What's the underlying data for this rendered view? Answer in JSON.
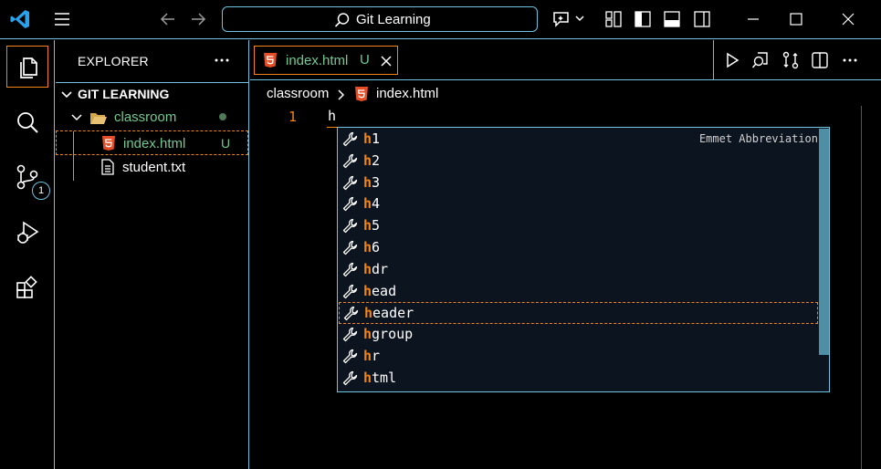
{
  "titlebar": {
    "search_text": "Git Learning"
  },
  "activity": {
    "source_control_badge": "1"
  },
  "sidebar": {
    "title": "EXPLORER",
    "root_label": "GIT LEARNING",
    "folder_label": "classroom",
    "files": [
      {
        "label": "index.html",
        "status": "U"
      },
      {
        "label": "student.txt",
        "status": ""
      }
    ]
  },
  "editor": {
    "tab": {
      "label": "index.html",
      "status": "U"
    },
    "breadcrumb": {
      "folder": "classroom",
      "file": "index.html"
    },
    "line_number": "1",
    "code": "h"
  },
  "suggest": {
    "detail": "Emmet Abbreviation",
    "items": [
      {
        "match": "h",
        "rest": "1"
      },
      {
        "match": "h",
        "rest": "2"
      },
      {
        "match": "h",
        "rest": "3"
      },
      {
        "match": "h",
        "rest": "4"
      },
      {
        "match": "h",
        "rest": "5"
      },
      {
        "match": "h",
        "rest": "6"
      },
      {
        "match": "h",
        "rest": "dr"
      },
      {
        "match": "h",
        "rest": "ead"
      },
      {
        "match": "h",
        "rest": "eader"
      },
      {
        "match": "h",
        "rest": "group"
      },
      {
        "match": "h",
        "rest": "r"
      },
      {
        "match": "h",
        "rest": "tml"
      }
    ],
    "focused_index": 8
  },
  "colors": {
    "accent_border": "#6fc3df",
    "focus_border": "#f38518",
    "untracked": "#73c991",
    "html_icon": "#e44d26"
  }
}
